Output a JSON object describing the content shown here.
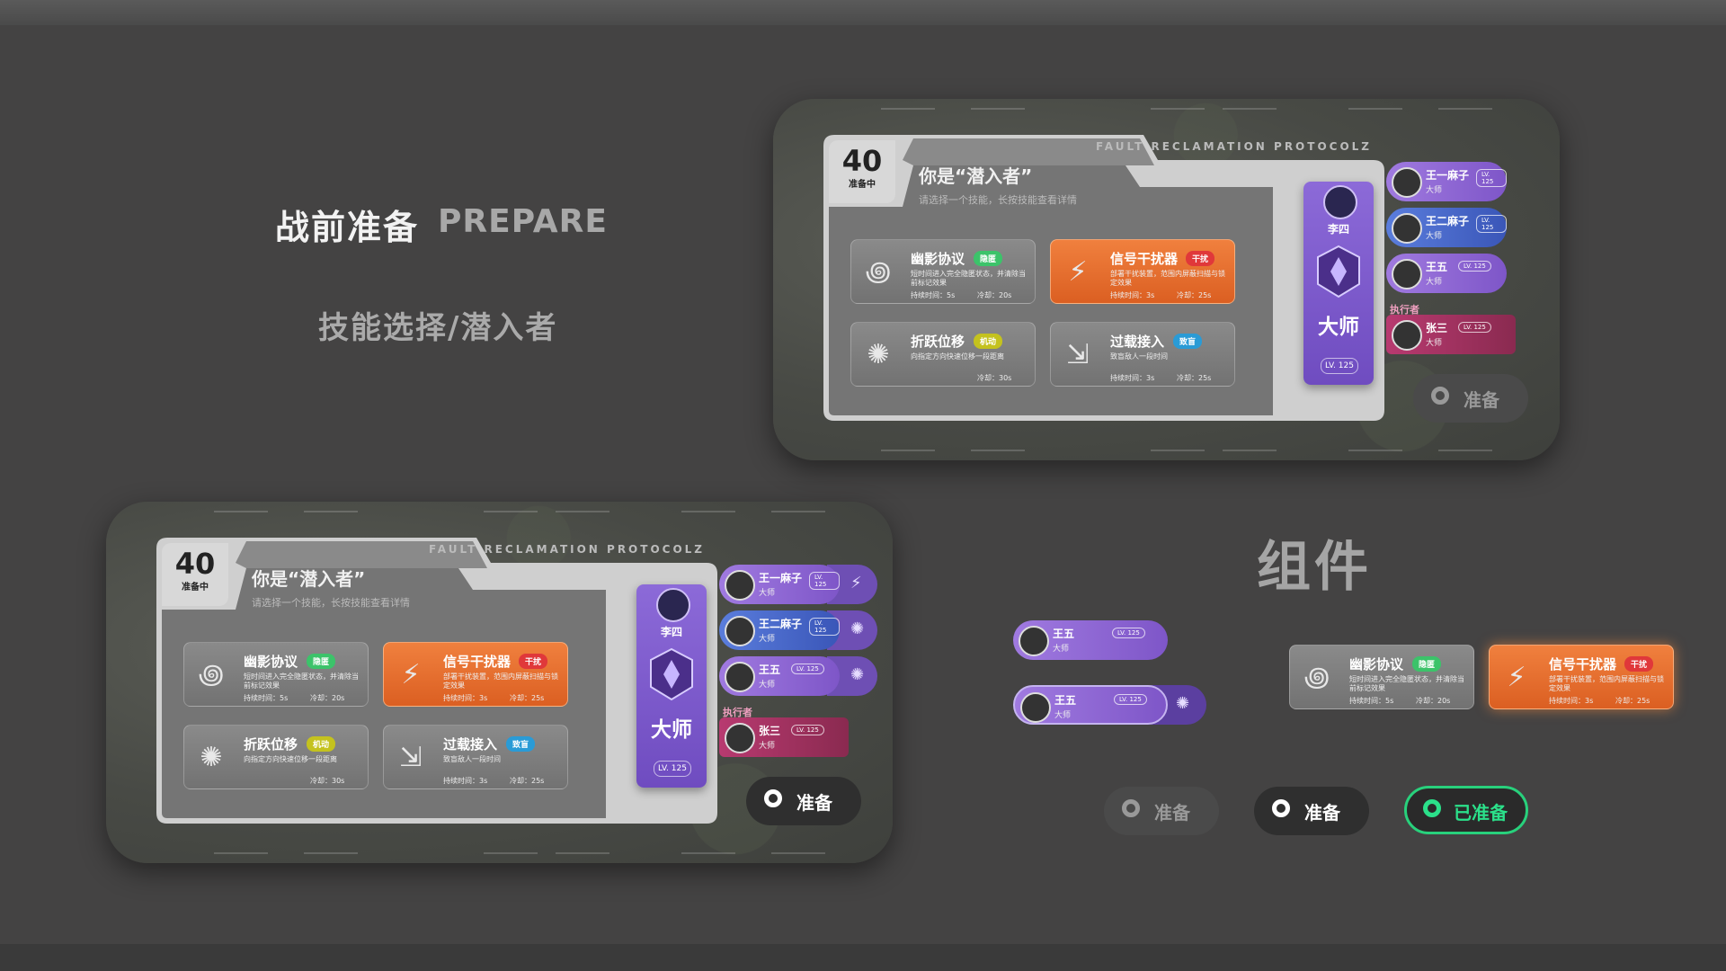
{
  "header": {
    "title_cn": "战前准备",
    "title_en": "PREPARE",
    "subtitle": "技能选择/潜入者"
  },
  "components_title": "组件",
  "panel": {
    "countdown": "40",
    "countdown_status": "准备中",
    "role_text": "你是“潜入者”",
    "hint": "请选择一个技能，长按技能查看详情",
    "protocol": "FAULT RECLAMATION PROTOCOLZ",
    "skills": [
      {
        "name": "幽影协议",
        "tag": "隐匿",
        "tag_color": "#3cc36a",
        "desc": "短时间进入完全隐匿状态，并清除当前标记效果",
        "duration": "持续时间：5s",
        "cooldown": "冷却：20s",
        "icon": "swirl-icon",
        "glyph": "꩜",
        "style": "gray"
      },
      {
        "name": "信号干扰器",
        "tag": "干扰",
        "tag_color": "#e0383a",
        "desc": "部署干扰装置，范围内屏蔽扫描与锁定效果",
        "duration": "持续时间：3s",
        "cooldown": "冷却：25s",
        "icon": "lightning-icon",
        "glyph": "⚡",
        "style": "orange"
      },
      {
        "name": "折跃位移",
        "tag": "机动",
        "tag_color": "#c4c21e",
        "desc": "向指定方向快速位移一段距离",
        "duration": "",
        "cooldown": "冷却：30s",
        "icon": "burst-icon",
        "glyph": "✺",
        "style": "gray"
      },
      {
        "name": "过载接入",
        "tag": "致盲",
        "tag_color": "#2a9bd6",
        "desc": "致盲敌人一段时间",
        "duration": "持续时间：3s",
        "cooldown": "冷却：25s",
        "icon": "claw-icon",
        "glyph": "⇲",
        "style": "gray"
      }
    ],
    "hero": {
      "name": "李四",
      "rank": "大师",
      "level": "LV. 125"
    },
    "teammates": [
      {
        "name": "王一麻子",
        "level": "LV. 125",
        "rank": "大师",
        "style": "purple",
        "side_icon": "⚡"
      },
      {
        "name": "王二麻子",
        "level": "LV. 125",
        "rank": "大师",
        "style": "blue",
        "side_icon": "✺"
      },
      {
        "name": "王五",
        "level": "LV. 125",
        "rank": "大师",
        "style": "purple",
        "side_icon": "✺"
      },
      {
        "name": "张三",
        "level": "LV. 125",
        "rank": "大师",
        "style": "red",
        "side_icon": ""
      }
    ],
    "executor_label": "执行者",
    "ready_label": "准备"
  },
  "components": {
    "teammate_a": {
      "name": "王五",
      "level": "LV. 125",
      "rank": "大师"
    },
    "teammate_b": {
      "name": "王五",
      "level": "LV. 125",
      "rank": "大师"
    },
    "buttons": [
      {
        "label": "准备",
        "state": "disabled"
      },
      {
        "label": "准备",
        "state": "default"
      },
      {
        "label": "已准备",
        "state": "ready"
      }
    ]
  },
  "colors": {
    "background": "#444343",
    "accent_purple": "#7e56c8",
    "accent_orange": "#e8702f",
    "ready_green": "#28d17c"
  }
}
